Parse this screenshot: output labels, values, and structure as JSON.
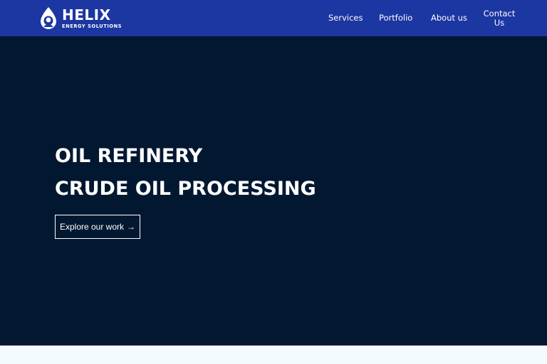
{
  "brand": {
    "name": "HELIX",
    "tagline": "ENERGY SOLUTIONS",
    "logo_icon": "oil-drop-icon",
    "color": "#1c36a2"
  },
  "nav": {
    "services": "Services",
    "portfolio": "Portfolio",
    "about": "About us",
    "contact_line1": "Contact",
    "contact_line2": "Us"
  },
  "hero": {
    "line1": "OIL REFINERY",
    "line2": "CRUDE OIL PROCESSING",
    "cta_label": "Explore our work",
    "cta_icon": "arrow-right-icon",
    "background": "#021831"
  }
}
